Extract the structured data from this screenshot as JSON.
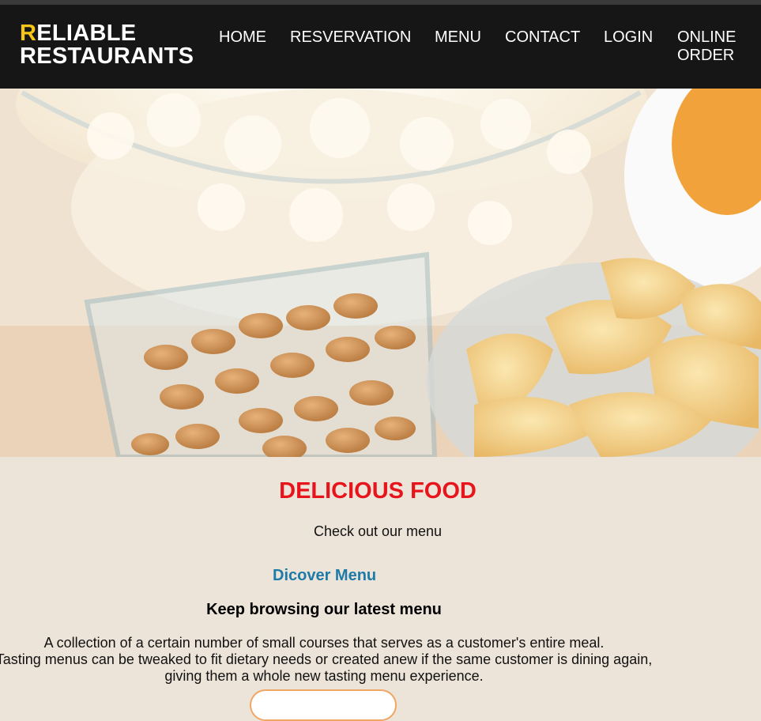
{
  "brand": {
    "first_letter": "R",
    "line1_rest": "ELIABLE",
    "line2": "RESTAURANTS",
    "accent_color": "#f5c518"
  },
  "nav": {
    "items": [
      {
        "label": "HOME"
      },
      {
        "label": "RESVERVATION"
      },
      {
        "label": "MENU"
      },
      {
        "label": "CONTACT"
      },
      {
        "label": "LOGIN"
      },
      {
        "label": "ONLINE ORDER"
      }
    ]
  },
  "hero": {
    "image": "snack bowls with popcorn, peanuts, potato chips"
  },
  "section": {
    "heading": "DELICIOUS FOOD",
    "heading_color": "#e8141c",
    "subheading": "Check out our menu",
    "discover_link": "Dicover Menu",
    "link_color": "#1e7aa8",
    "browse_heading": "Keep browsing our latest menu",
    "description_lines": [
      "A collection of a certain number of small courses that serves as a customer's entire meal.",
      "Tasting menus can be tweaked to fit dietary needs or created anew if the same customer is dining again,",
      "giving them a whole new tasting menu experience."
    ]
  }
}
